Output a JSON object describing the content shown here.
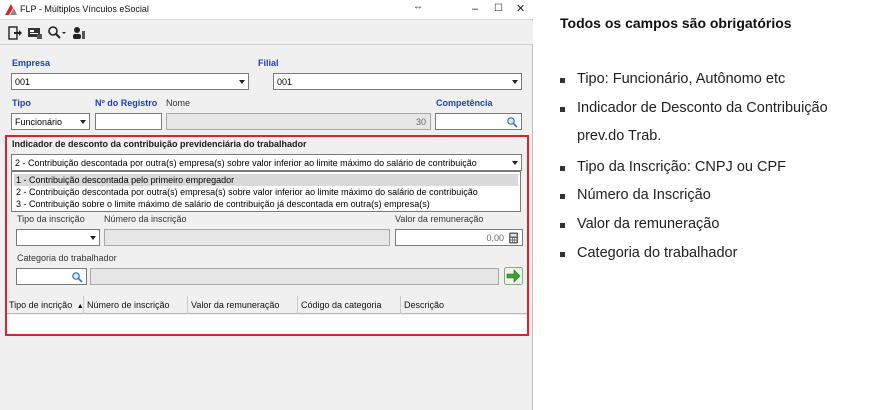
{
  "window": {
    "title": "FLP - Múltiplos Vínculos eSocial",
    "controls": {
      "minimize": "–",
      "maximize": "☐",
      "close": "✕"
    }
  },
  "toolbar": {
    "buttons": [
      {
        "name": "exit-icon"
      },
      {
        "name": "card-icon"
      },
      {
        "name": "search-icon"
      },
      {
        "name": "user-icon"
      }
    ]
  },
  "form": {
    "empresa": {
      "label": "Empresa",
      "value": "001"
    },
    "filial": {
      "label": "Filial",
      "value": "001"
    },
    "tipo": {
      "label": "Tipo",
      "value": "Funcionário"
    },
    "registro": {
      "label": "Nº do Registro",
      "value": ""
    },
    "nome": {
      "label": "Nome",
      "value": "30"
    },
    "competencia": {
      "label": "Competência",
      "value": ""
    }
  },
  "indicador": {
    "label": "Indicador de desconto da contribuição previdenciária do trabalhador",
    "selected": "2 - Contribuição descontada por outra(s) empresa(s) sobre valor inferior ao limite máximo do salário de contribuição",
    "options": [
      "1 - Contribuição descontada pelo primeiro empregador",
      "2 - Contribuição descontada por outra(s) empresa(s) sobre valor inferior ao limite máximo do salário de contribuição",
      "3 - Contribuição sobre o limite máximo de salário de contribuição já descontada em outra(s) empresa(s)"
    ]
  },
  "inscricao": {
    "tipo_label": "Tipo da inscrição",
    "numero_label": "Número da inscrição",
    "valor_label": "Valor da remuneração",
    "valor_value": "0,00",
    "categoria_label": "Categoria do trabalhador"
  },
  "grid": {
    "columns": [
      "Tipo de incrição",
      "Número de inscrição",
      "Valor da remuneração",
      "Código da categoria",
      "Descrição"
    ]
  },
  "notes": {
    "title": "Todos os campos são obrigatórios",
    "items": [
      "Tipo: Funcionário, Autônomo etc",
      "Indicador  de  Desconto  da  Contribuição",
      "prev.do Trab.",
      "Tipo da Inscrição: CNPJ ou CPF",
      "Número da Inscrição",
      "Valor da remuneração",
      "Categoria do trabalhador"
    ]
  },
  "colors": {
    "highlight_border": "#d9242b",
    "label_blue": "#1f3fbf"
  }
}
